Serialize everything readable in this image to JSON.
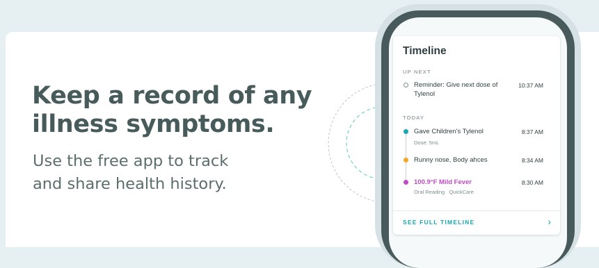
{
  "hero": {
    "headline_line1": "Keep a record of any",
    "headline_line2": "illness symptoms.",
    "subline_line1": "Use the free app to track",
    "subline_line2": "and share health history."
  },
  "timeline": {
    "title": "Timeline",
    "up_next_label": "UP NEXT",
    "today_label": "TODAY",
    "up_next": {
      "text_line1": "Reminder: Give next dose of",
      "text_line2": "Tylenol",
      "time": "10:37 AM"
    },
    "entries": [
      {
        "text": "Gave Children's Tylenol",
        "time": "8:37 AM",
        "sub": "Dose: 5mL",
        "color": "#16a7b5"
      },
      {
        "text": "Runny nose, Body ahces",
        "time": "8:34 AM",
        "sub": "",
        "color": "#f5a623"
      },
      {
        "text": "100.9°F Mild Fever",
        "time": "8:30 AM",
        "sub_reading": "Oral Reading",
        "sub_source": "QuickCare",
        "color": "#c04bc6"
      }
    ],
    "see_all_label": "SEE FULL TIMELINE",
    "see_all_icon": "chevron-right-icon"
  },
  "colors": {
    "accent": "#16a7b5",
    "headline": "#485b5b",
    "fever": "#c04bc6"
  }
}
